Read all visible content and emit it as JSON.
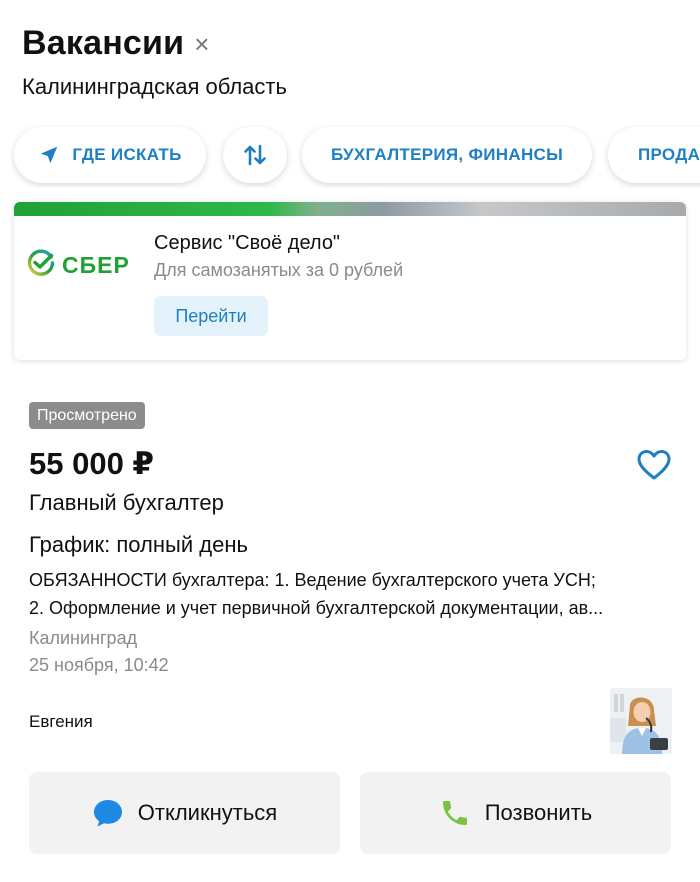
{
  "header": {
    "title": "Вакансии",
    "close_symbol": "×",
    "region": "Калининградская область"
  },
  "filters": {
    "where_label": "ГДЕ ИСКАТЬ",
    "sort_icon": "sort-arrows-icon",
    "category_label": "БУХГАЛТЕРИЯ, ФИНАНСЫ",
    "next_label": "ПРОДА"
  },
  "ad": {
    "brand": "СБЕР",
    "title": "Сервис \"Своё дело\"",
    "subtitle": "Для самозанятых за 0 рублей",
    "button": "Перейти"
  },
  "vacancy": {
    "viewed_badge": "Просмотрено",
    "salary": "55 000 ₽",
    "title": "Главный бухгалтер",
    "schedule": "График: полный день",
    "description_line1": "ОБЯЗАННОСТИ бухгалтера: 1. Ведение бухгалтерского учета УСН;",
    "description_line2": "2.  Оформление и учет первичной бухгалтерской документации, ав...",
    "city": "Калининград",
    "date": "25 ноября, 10:42",
    "author": "Евгения"
  },
  "actions": {
    "respond": "Откликнуться",
    "call": "Позвонить"
  },
  "colors": {
    "accent_blue": "#1e7fc4",
    "sber_green": "#21a038",
    "call_green": "#7cc242",
    "chat_blue": "#1e88e5"
  }
}
